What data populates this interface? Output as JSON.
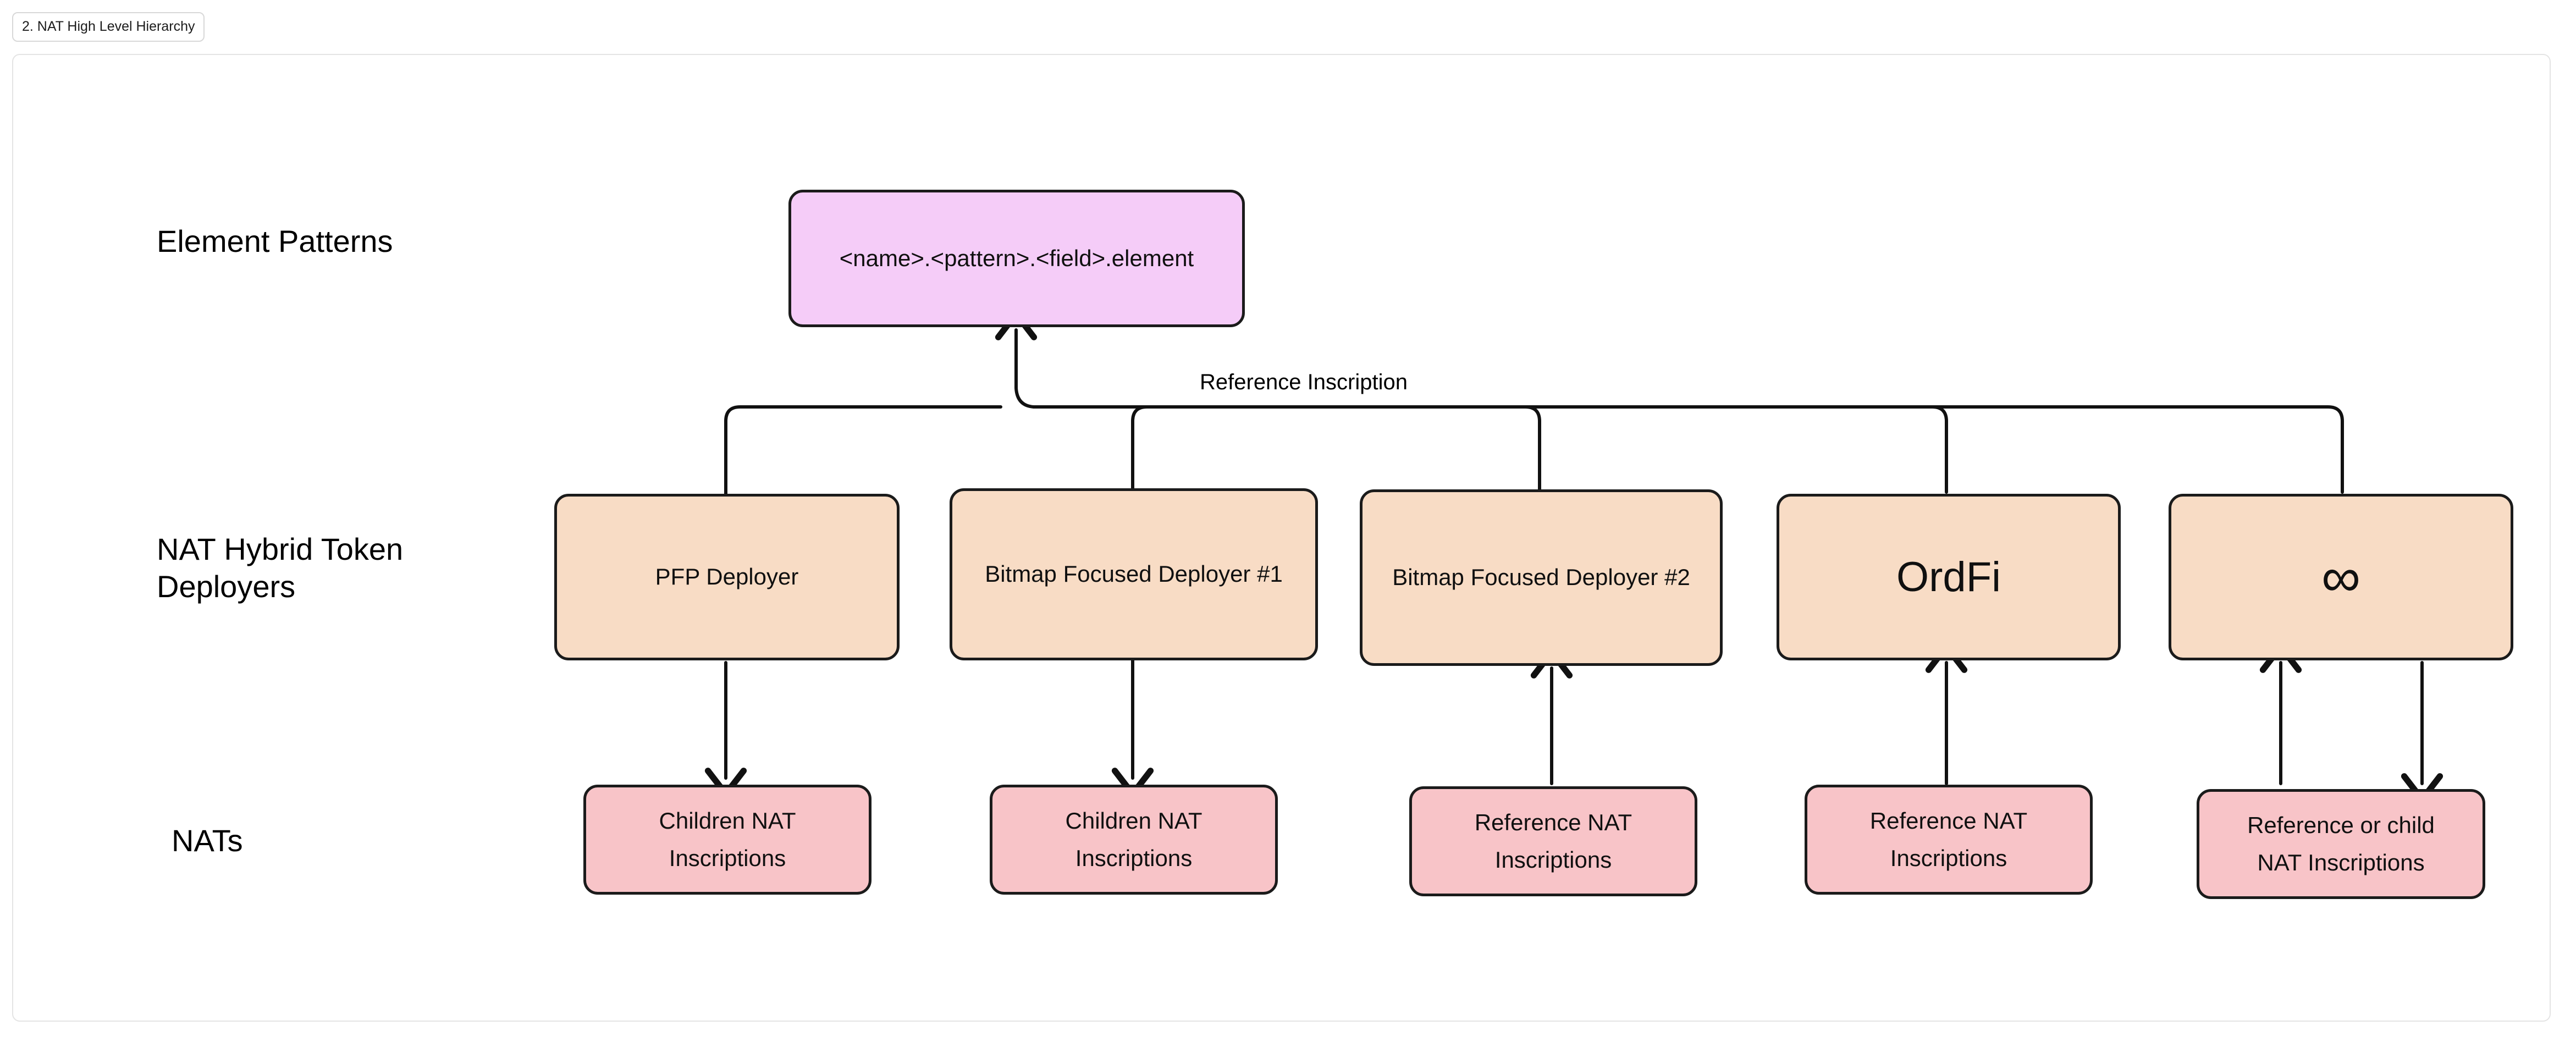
{
  "tabs": [
    {
      "label": "2. NAT High Level Hierarchy"
    }
  ],
  "colors": {
    "pattern_fill": "#f5ccf8",
    "deployer_fill": "#f8dcc5",
    "nat_fill": "#f8c4c8",
    "node_stroke": "#1b1b1b",
    "edge_stroke": "#111111",
    "frame_border": "#e4e4e4",
    "background": "#ffffff"
  },
  "row_labels": [
    {
      "id": "element-patterns",
      "text": "Element Patterns"
    },
    {
      "id": "nat-hybrid-token-deployers",
      "text": "NAT Hybrid Token\nDeployers"
    },
    {
      "id": "nats",
      "text": "NATs"
    }
  ],
  "nodes": {
    "pattern": {
      "id": "element-pattern-node",
      "label": "<name>.<pattern>.<field>.element"
    },
    "deployers": [
      {
        "id": "pfp-deployer",
        "label": "PFP Deployer",
        "style": "normal"
      },
      {
        "id": "bitmap-focused-deployer-1",
        "label": "Bitmap Focused Deployer #1",
        "style": "normal"
      },
      {
        "id": "bitmap-focused-deployer-2",
        "label": "Bitmap Focused Deployer #2",
        "style": "normal"
      },
      {
        "id": "ordfi-deployer",
        "label": "OrdFi",
        "style": "big"
      },
      {
        "id": "infinity-deployer",
        "label": "∞",
        "style": "glyph"
      }
    ],
    "nats": [
      {
        "id": "children-nat-inscriptions-1",
        "label": "Children NAT\nInscriptions"
      },
      {
        "id": "children-nat-inscriptions-2",
        "label": "Children NAT\nInscriptions"
      },
      {
        "id": "reference-nat-inscriptions-1",
        "label": "Reference NAT\nInscriptions"
      },
      {
        "id": "reference-nat-inscriptions-2",
        "label": "Reference NAT\nInscriptions"
      },
      {
        "id": "reference-or-child-nat-inscriptions",
        "label": "Reference or child\nNAT Inscriptions"
      }
    ]
  },
  "edge_labels": [
    {
      "id": "reference-inscription-label",
      "text": "Reference Inscription"
    }
  ]
}
